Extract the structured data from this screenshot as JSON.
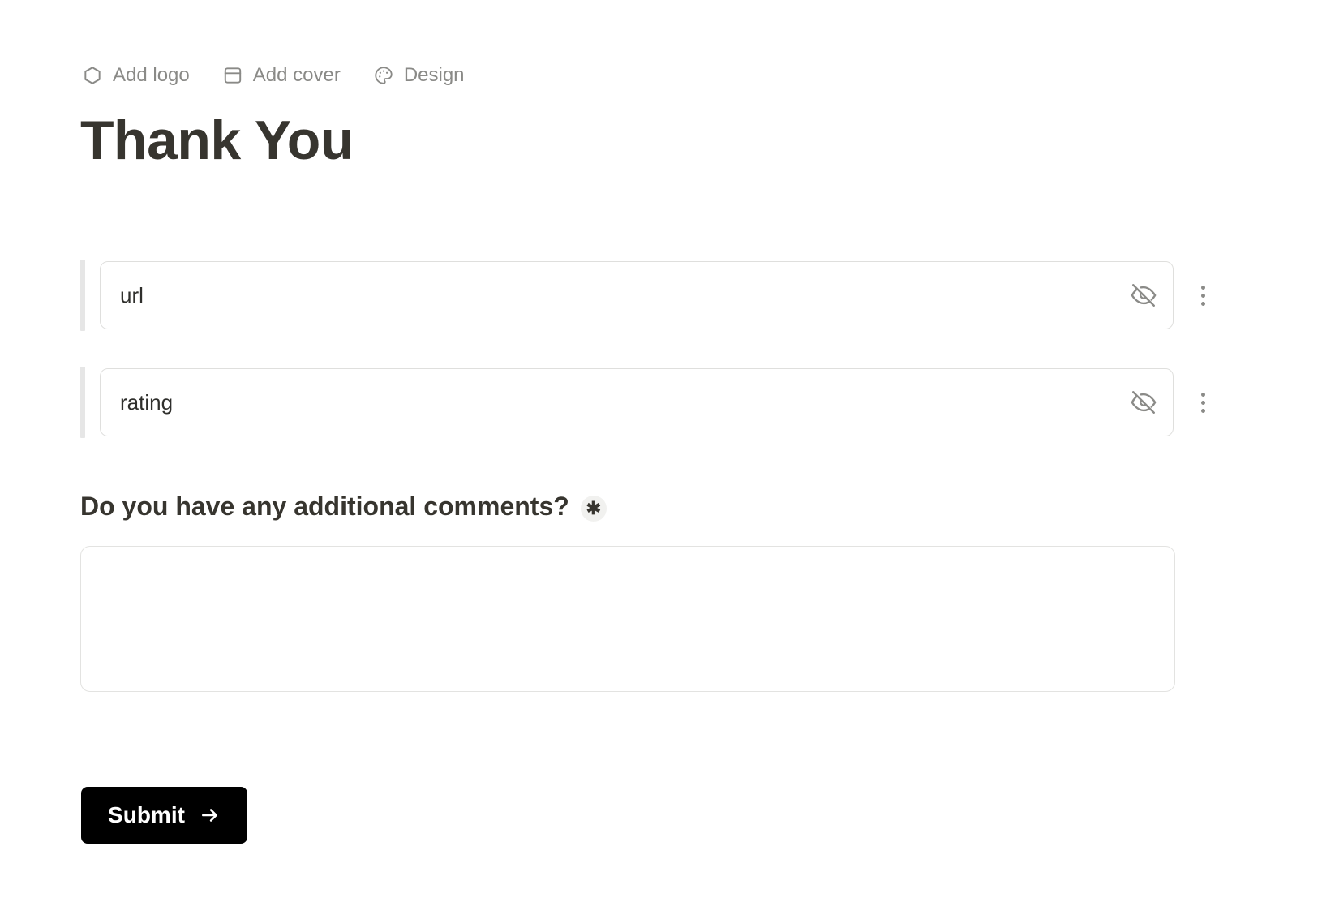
{
  "page": {
    "background_color": "#ffffff",
    "title": "Thank You",
    "title_color": "#37352f"
  },
  "toolbar": {
    "items": [
      {
        "label": "Add logo",
        "icon": "hexagon-icon"
      },
      {
        "label": "Add cover",
        "icon": "panel-top-icon"
      },
      {
        "label": "Design",
        "icon": "palette-icon"
      }
    ]
  },
  "fields": [
    {
      "value": "url",
      "placeholder": "url",
      "hidden_icon": "eye-off-icon",
      "menu_icon": "kebab-menu-icon",
      "marker_color": "#e6e6e6"
    },
    {
      "value": "rating",
      "placeholder": "rating",
      "hidden_icon": "eye-off-icon",
      "menu_icon": "kebab-menu-icon",
      "marker_color": "#e6e6e6"
    }
  ],
  "question": {
    "label": "Do you have any additional comments?",
    "required_marker": "✱",
    "answer_value": "",
    "answer_placeholder": ""
  },
  "submit": {
    "label": "Submit",
    "icon": "arrow-right-icon",
    "background_color": "#000000",
    "text_color": "#ffffff"
  }
}
